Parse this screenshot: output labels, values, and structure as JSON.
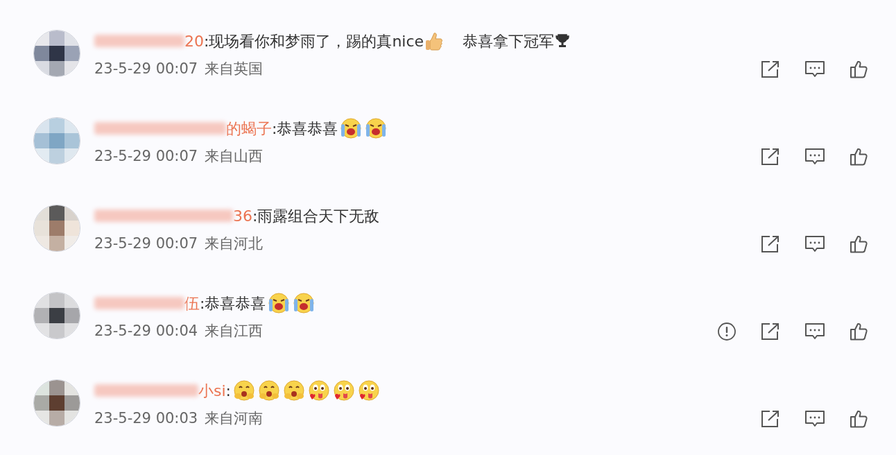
{
  "comments": [
    {
      "name": "20",
      "content": [
        {
          "kind": "text",
          "text": ":现场看你和梦雨了，踢的真nice"
        },
        {
          "kind": "thumb"
        },
        {
          "kind": "text",
          "text": "恭喜拿下冠军"
        },
        {
          "kind": "trophy"
        }
      ],
      "time": "23-5-29 00:07",
      "location": "来自英国",
      "report": false
    },
    {
      "name": "的蝎子",
      "content": [
        {
          "kind": "text",
          "text": ":恭喜恭喜"
        },
        {
          "kind": "cry"
        },
        {
          "kind": "cry"
        }
      ],
      "time": "23-5-29 00:07",
      "location": "来自山西",
      "report": false
    },
    {
      "name": "36",
      "content": [
        {
          "kind": "text",
          "text": ":雨露组合天下无敌"
        }
      ],
      "time": "23-5-29 00:07",
      "location": "来自河北",
      "report": false
    },
    {
      "name": "伍",
      "content": [
        {
          "kind": "text",
          "text": ":恭喜恭喜"
        },
        {
          "kind": "cry"
        },
        {
          "kind": "cry"
        }
      ],
      "time": "23-5-29 00:04",
      "location": "来自江西",
      "report": true
    },
    {
      "name": "小si",
      "content": [
        {
          "kind": "text",
          "text": ":"
        },
        {
          "kind": "shy"
        },
        {
          "kind": "shy"
        },
        {
          "kind": "shy"
        },
        {
          "kind": "tongue"
        },
        {
          "kind": "tongue"
        },
        {
          "kind": "tongue"
        }
      ],
      "time": "23-5-29 00:03",
      "location": "来自河南",
      "report": false
    }
  ]
}
